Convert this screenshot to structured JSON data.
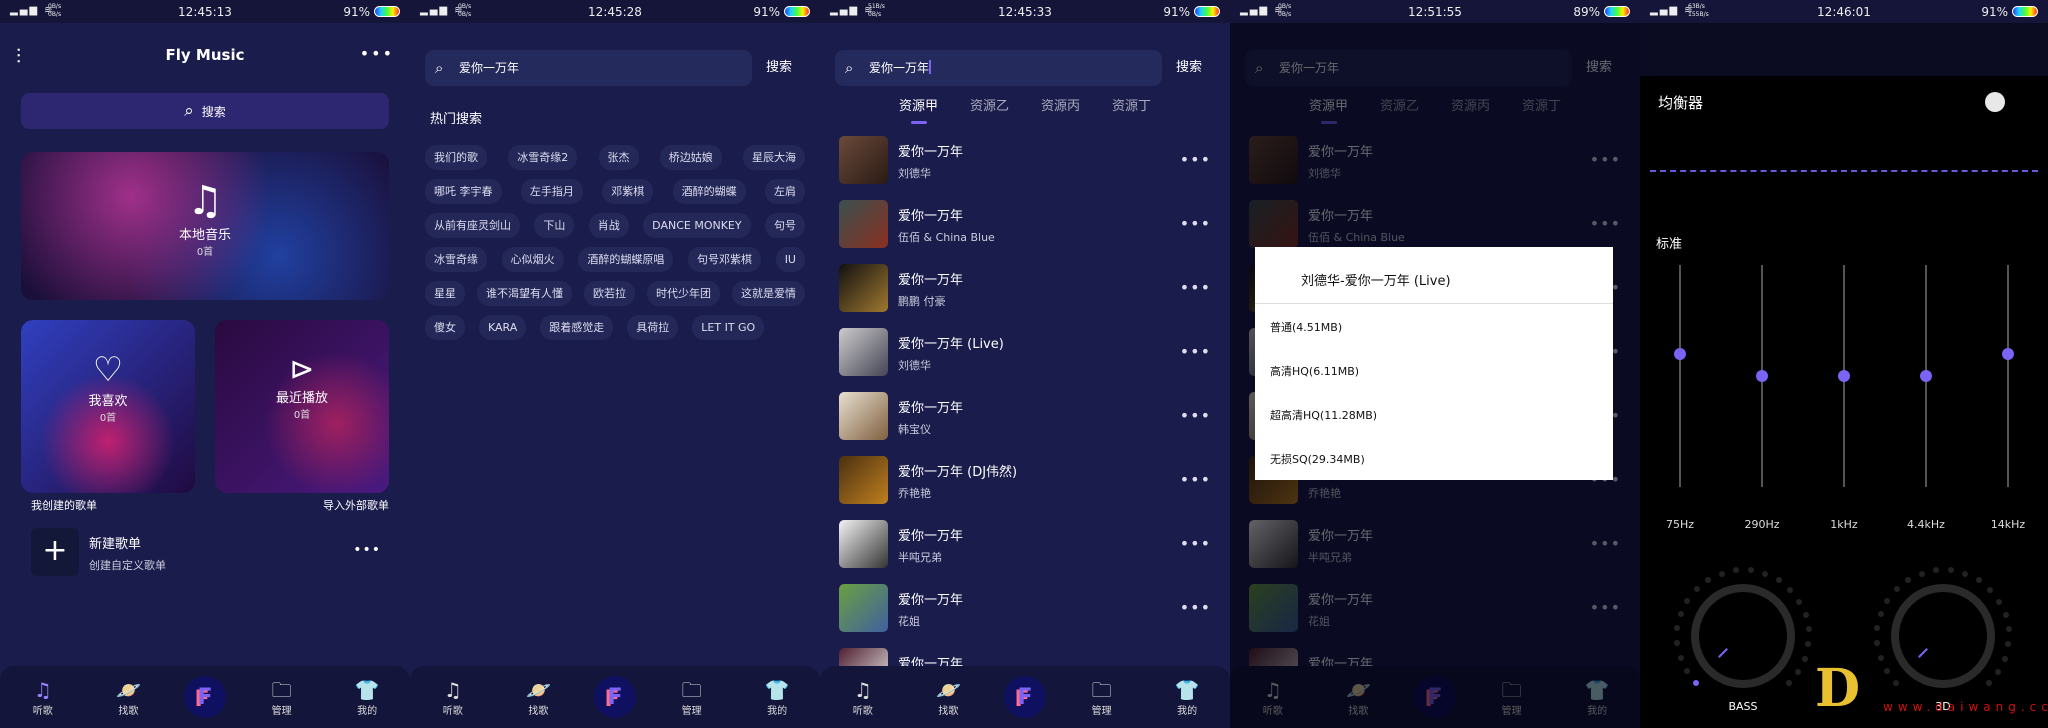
{
  "colors": {
    "background": "#1a1c4c",
    "accent": "#7b63f5",
    "nav": "#14153a",
    "eq_background": "#000000"
  },
  "nav": {
    "items": [
      {
        "label": "听歌",
        "icon": "music-note-icon"
      },
      {
        "label": "找歌",
        "icon": "planet-icon"
      },
      {
        "label": "",
        "icon": "app-logo-icon"
      },
      {
        "label": "管理",
        "icon": "folder-icon"
      },
      {
        "label": "我的",
        "icon": "shirt-icon"
      }
    ]
  },
  "screens": [
    {
      "status": {
        "time": "12:45:13",
        "battery": "91%",
        "net_up": "0B/s",
        "net_down": "0B/s"
      },
      "active_nav": 0,
      "header": {
        "title": "Fly Music"
      },
      "search_placeholder": "搜索",
      "local": {
        "label": "本地音乐",
        "count": "0首"
      },
      "liked": {
        "label": "我喜欢",
        "count": "0首"
      },
      "recent": {
        "label": "最近播放",
        "count": "0首"
      },
      "my_playlists": "我创建的歌单",
      "import_playlists": "导入外部歌单",
      "new_playlist": {
        "title": "新建歌单",
        "subtitle": "创建自定义歌单"
      }
    },
    {
      "status": {
        "time": "12:45:28",
        "battery": "91%",
        "net_up": "0B/s",
        "net_down": "0B/s"
      },
      "active_nav": 1,
      "search_value": "爱你一万年",
      "search_button": "搜索",
      "hot_title": "热门搜索",
      "hot_rows": [
        [
          "我们的歌",
          "冰雪奇缘2",
          "张杰",
          "桥边姑娘",
          "星辰大海"
        ],
        [
          "哪吒 李宇春",
          "左手指月",
          "邓紫棋",
          "酒醉的蝴蝶",
          "左肩"
        ],
        [
          "从前有座灵剑山",
          "下山",
          "肖战",
          "DANCE MONKEY",
          "句号"
        ],
        [
          "冰雪奇缘",
          "心似烟火",
          "酒醉的蝴蝶原唱",
          "句号邓紫棋",
          "IU"
        ],
        [
          "星星",
          "谁不渴望有人懂",
          "欧若拉",
          "时代少年团",
          "这就是爱情"
        ],
        [
          "傻女",
          "KARA",
          "跟着感觉走",
          "具荷拉",
          "LET IT GO"
        ]
      ]
    },
    {
      "status": {
        "time": "12:45:33",
        "battery": "91%",
        "net_up": "51B/s",
        "net_down": "0B/s"
      },
      "active_nav": 1,
      "search_value": "爱你一万年",
      "search_button": "搜索",
      "tabs": [
        "资源甲",
        "资源乙",
        "资源丙",
        "资源丁"
      ],
      "active_tab": 0,
      "songs": [
        {
          "title": "爱你一万年",
          "artist": "刘德华"
        },
        {
          "title": "爱你一万年",
          "artist": "伍佰 & China Blue"
        },
        {
          "title": "爱你一万年",
          "artist": "鹏鹏 付豪"
        },
        {
          "title": "爱你一万年 (Live)",
          "artist": "刘德华"
        },
        {
          "title": "爱你一万年",
          "artist": "韩宝仪"
        },
        {
          "title": "爱你一万年 (DJ伟然)",
          "artist": "乔艳艳"
        },
        {
          "title": "爱你一万年",
          "artist": "半吨兄弟"
        },
        {
          "title": "爱你一万年",
          "artist": "花姐"
        },
        {
          "title": "爱你一万年",
          "artist": ""
        }
      ]
    },
    {
      "status": {
        "time": "12:51:55",
        "battery": "89%",
        "net_up": "0B/s",
        "net_down": "0B/s"
      },
      "active_nav": -1,
      "search_value": "爱你一万年",
      "search_button": "搜索",
      "tabs": [
        "资源甲",
        "资源乙",
        "资源丙",
        "资源丁"
      ],
      "active_tab": 0,
      "songs": [
        {
          "title": "爱你一万年",
          "artist": "刘德华"
        },
        {
          "title": "爱你一万年",
          "artist": "伍佰 & China Blue"
        },
        {
          "title": "",
          "artist": ""
        },
        {
          "title": "",
          "artist": ""
        },
        {
          "title": "",
          "artist": ""
        },
        {
          "title": "",
          "artist": "乔艳艳"
        },
        {
          "title": "爱你一万年",
          "artist": "半吨兄弟"
        },
        {
          "title": "爱你一万年",
          "artist": "花姐"
        },
        {
          "title": "爱你一万年",
          "artist": ""
        }
      ],
      "dialog": {
        "title": "刘德华-爱你一万年 (Live)",
        "options": [
          "普通(4.51MB)",
          "高清HQ(6.11MB)",
          "超高清HQ(11.28MB)",
          "无损SQ(29.34MB)"
        ]
      }
    },
    {
      "status": {
        "time": "12:46:01",
        "battery": "91%",
        "net_up": "63B/s",
        "net_down": "155B/s"
      },
      "eq": {
        "title": "均衡器",
        "enabled": false,
        "preset": "标准",
        "bands": [
          {
            "label": "75Hz",
            "level": 0.6
          },
          {
            "label": "290Hz",
            "level": 0.5
          },
          {
            "label": "1kHz",
            "level": 0.5
          },
          {
            "label": "4.4kHz",
            "level": 0.5
          },
          {
            "label": "14kHz",
            "level": 0.6
          }
        ],
        "knobs": [
          {
            "label": "BASS",
            "value": 0
          },
          {
            "label": "3D",
            "value": 0
          }
        ]
      },
      "watermark": "www.daiwang.cc"
    }
  ]
}
